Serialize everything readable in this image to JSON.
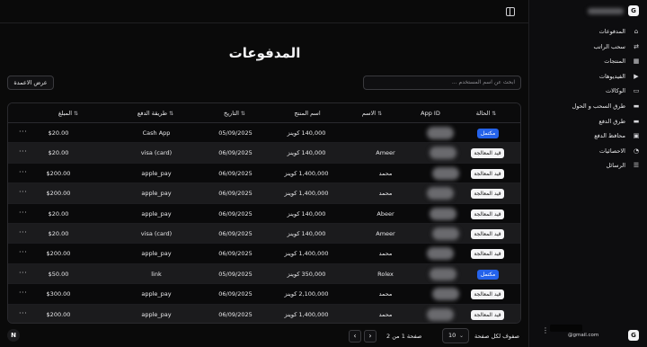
{
  "page": {
    "title": "المدفوعات",
    "columns_button": "عرض الاعمدة",
    "search_placeholder": "ابحث عن اسم المستخدم ..."
  },
  "table": {
    "headers": {
      "status": "الحالة",
      "app_id": "App ID",
      "name": "الاسم",
      "product": "اسم المنتج",
      "date": "التاريخ",
      "method": "طريقة الدفع",
      "amount": "المبلغ"
    },
    "rows": [
      {
        "status": "مكتمل",
        "status_kind": "done",
        "name": "",
        "product": "140,000 كوينز",
        "date": "05/09/2025",
        "method": "Cash App",
        "amount": "$20.00"
      },
      {
        "status": "قيد المعالجة",
        "status_kind": "pending",
        "name": "Ameer",
        "product": "140,000 كوينز",
        "date": "06/09/2025",
        "method": "visa (card)",
        "amount": "$20.00"
      },
      {
        "status": "قيد المعالجة",
        "status_kind": "pending",
        "name": "محمد",
        "product": "1,400,000 كوينز",
        "date": "06/09/2025",
        "method": "apple_pay",
        "amount": "$200.00"
      },
      {
        "status": "قيد المعالجة",
        "status_kind": "pending",
        "name": "محمد",
        "product": "1,400,000 كوينز",
        "date": "06/09/2025",
        "method": "apple_pay",
        "amount": "$200.00"
      },
      {
        "status": "قيد المعالجة",
        "status_kind": "pending",
        "name": "Abeer",
        "product": "140,000 كوينز",
        "date": "06/09/2025",
        "method": "apple_pay",
        "amount": "$20.00"
      },
      {
        "status": "قيد المعالجة",
        "status_kind": "pending",
        "name": "Ameer",
        "product": "140,000 كوينز",
        "date": "06/09/2025",
        "method": "visa (card)",
        "amount": "$20.00"
      },
      {
        "status": "قيد المعالجة",
        "status_kind": "pending",
        "name": "محمد",
        "product": "1,400,000 كوينز",
        "date": "06/09/2025",
        "method": "apple_pay",
        "amount": "$200.00"
      },
      {
        "status": "مكتمل",
        "status_kind": "done",
        "name": "Rolex",
        "product": "350,000 كوينز",
        "date": "05/09/2025",
        "method": "link",
        "amount": "$50.00"
      },
      {
        "status": "قيد المعالجة",
        "status_kind": "pending",
        "name": "محمد",
        "product": "2,100,000 كوينز",
        "date": "06/09/2025",
        "method": "apple_pay",
        "amount": "$300.00"
      },
      {
        "status": "قيد المعالجة",
        "status_kind": "pending",
        "name": "محمد",
        "product": "1,400,000 كوينز",
        "date": "06/09/2025",
        "method": "apple_pay",
        "amount": "$200.00"
      }
    ],
    "row_actions": "···"
  },
  "pagination": {
    "rows_per_page_label": "صفوف لكل صفحة",
    "rows_per_page_value": "10",
    "page_info": "صفحة 1 من 2",
    "prev": "‹",
    "next": "›"
  },
  "footer": {
    "bubble": "N"
  },
  "sidebar": {
    "logo": "G",
    "items": [
      {
        "label": "المدفوعات",
        "icon": "home-icon",
        "glyph": "⌂"
      },
      {
        "label": "سحب الراتب",
        "icon": "transfer-icon",
        "glyph": "⇄"
      },
      {
        "label": "المنتجات",
        "icon": "grid-icon",
        "glyph": "▦"
      },
      {
        "label": "الفيديوهات",
        "icon": "video-icon",
        "glyph": "▶"
      },
      {
        "label": "الوكالات",
        "icon": "folder-icon",
        "glyph": "▭"
      },
      {
        "label": "طرق السحب و الحول",
        "icon": "credit-card-icon",
        "glyph": "▬"
      },
      {
        "label": "طرق الدفع",
        "icon": "credit-card-icon",
        "glyph": "▬"
      },
      {
        "label": "محافظ الدفع",
        "icon": "wallet-icon",
        "glyph": "▣"
      },
      {
        "label": "الاحصائيات",
        "icon": "chart-icon",
        "glyph": "◔"
      },
      {
        "label": "الرسائل",
        "icon": "list-icon",
        "glyph": "☰"
      }
    ],
    "user": {
      "logo": "G",
      "email": "@gmail.com",
      "menu": "⋮"
    }
  }
}
